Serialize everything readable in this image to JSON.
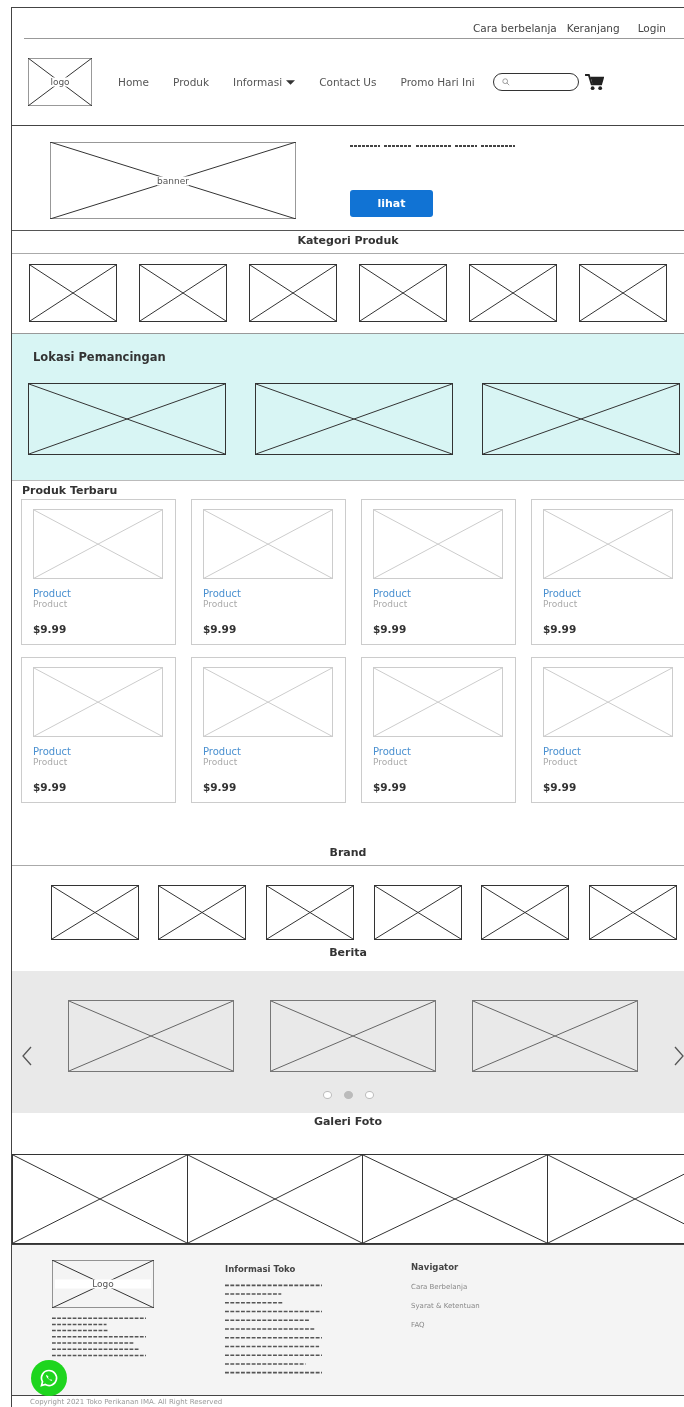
{
  "top_links": [
    "Cara berbelanja",
    "Keranjang",
    "Login"
  ],
  "header": {
    "logo_label": "logo",
    "nav": [
      {
        "label": "Home",
        "kind": "link"
      },
      {
        "label": "Produk",
        "kind": "link"
      },
      {
        "label": "Informasi",
        "kind": "dropdown"
      },
      {
        "label": "Contact Us",
        "kind": "link"
      },
      {
        "label": "Promo Hari Ini",
        "kind": "link"
      }
    ]
  },
  "hero": {
    "banner_label": "banner",
    "button": "lihat"
  },
  "categories": {
    "title": "Kategori Produk",
    "items": [
      {
        "kind": "image"
      },
      {
        "kind": "image"
      },
      {
        "kind": "image"
      },
      {
        "kind": "image"
      },
      {
        "kind": "image"
      },
      {
        "kind": "image"
      }
    ]
  },
  "locations": {
    "title": "Lokasi Pemancingan",
    "items": [
      {
        "kind": "image"
      },
      {
        "kind": "image"
      },
      {
        "kind": "image"
      }
    ]
  },
  "products": {
    "title": "Produk Terbaru",
    "items": [
      {
        "name": "Product",
        "subtitle": "Product",
        "price": "$9.99"
      },
      {
        "name": "Product",
        "subtitle": "Product",
        "price": "$9.99"
      },
      {
        "name": "Product",
        "subtitle": "Product",
        "price": "$9.99"
      },
      {
        "name": "Product",
        "subtitle": "Product",
        "price": "$9.99"
      },
      {
        "name": "Product",
        "subtitle": "Product",
        "price": "$9.99"
      },
      {
        "name": "Product",
        "subtitle": "Product",
        "price": "$9.99"
      },
      {
        "name": "Product",
        "subtitle": "Product",
        "price": "$9.99"
      },
      {
        "name": "Product",
        "subtitle": "Product",
        "price": "$9.99"
      }
    ]
  },
  "brands": {
    "title": "Brand",
    "items": [
      {
        "kind": "image"
      },
      {
        "kind": "image"
      },
      {
        "kind": "image"
      },
      {
        "kind": "image"
      },
      {
        "kind": "image"
      },
      {
        "kind": "image"
      }
    ]
  },
  "news": {
    "title": "Berita",
    "slides": [
      {
        "kind": "image"
      },
      {
        "kind": "image"
      },
      {
        "kind": "image"
      }
    ],
    "dots": [
      {
        "selected": false
      },
      {
        "selected": true
      },
      {
        "selected": false
      }
    ]
  },
  "gallery": {
    "title": "Galeri Foto",
    "items": [
      {
        "kind": "image"
      },
      {
        "kind": "image"
      },
      {
        "kind": "image"
      },
      {
        "kind": "image"
      }
    ]
  },
  "footer": {
    "logo_label": "Logo",
    "info_title": "Informasi Toko",
    "nav_title": "Navigator",
    "nav_links": [
      "Cara Berbelanja",
      "Syarat & Ketentuan",
      "FAQ"
    ],
    "copyright": "Copyright 2021 Toko Perikanan IMA. All Right Reserved"
  }
}
